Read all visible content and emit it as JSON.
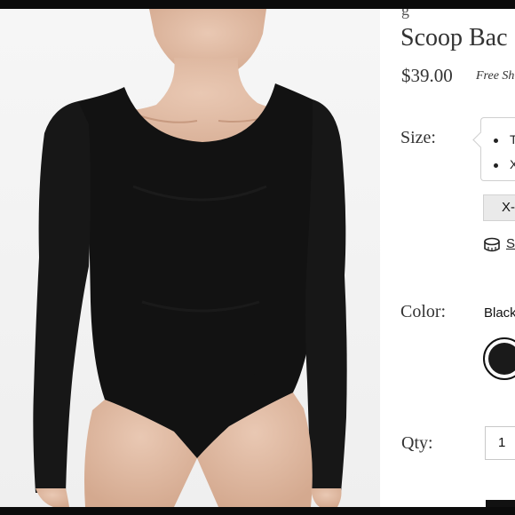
{
  "product": {
    "brand_partial": "g",
    "title": "Scoop Bac",
    "price": "$39.00",
    "shipping": "Free Sh"
  },
  "size": {
    "label": "Size:",
    "tooltip_items": [
      "T",
      "X"
    ],
    "selected": "X-",
    "guide_link": "S"
  },
  "color": {
    "label": "Color:",
    "value": "Black",
    "swatch_color": "#1a1a1a"
  },
  "quantity": {
    "label": "Qty:",
    "value": "1"
  }
}
